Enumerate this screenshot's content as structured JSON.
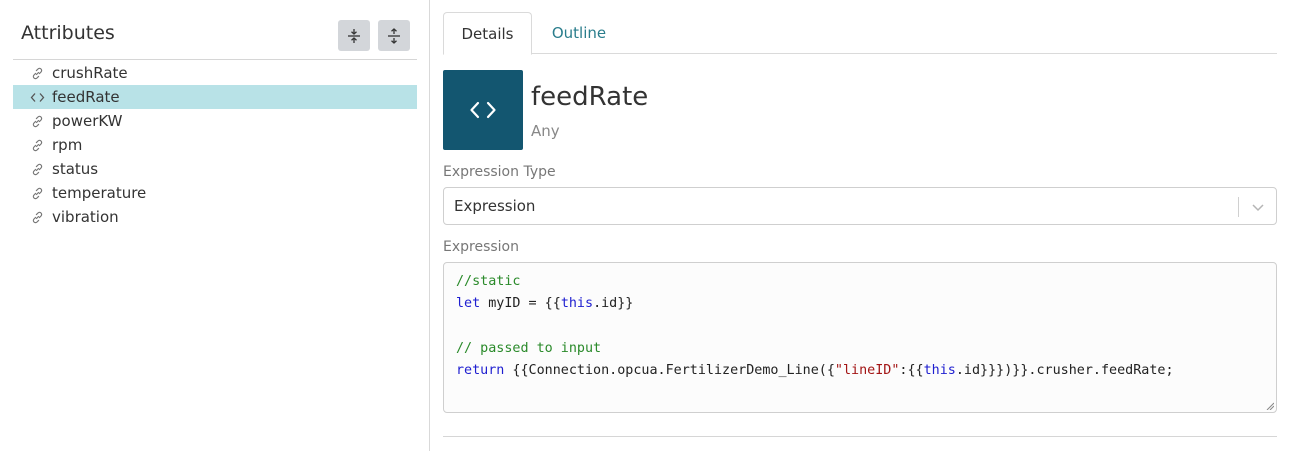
{
  "attributes_panel": {
    "title": "Attributes",
    "collapse_all_icon": "collapse-vertical-icon",
    "expand_all_icon": "expand-vertical-icon",
    "items": [
      {
        "label": "crushRate",
        "icon": "link-icon",
        "selected": false
      },
      {
        "label": "feedRate",
        "icon": "code-icon",
        "selected": true
      },
      {
        "label": "powerKW",
        "icon": "link-icon",
        "selected": false
      },
      {
        "label": "rpm",
        "icon": "link-icon",
        "selected": false
      },
      {
        "label": "status",
        "icon": "link-icon",
        "selected": false
      },
      {
        "label": "temperature",
        "icon": "link-icon",
        "selected": false
      },
      {
        "label": "vibration",
        "icon": "link-icon",
        "selected": false
      }
    ]
  },
  "tabs": [
    {
      "label": "Details",
      "active": true
    },
    {
      "label": "Outline",
      "active": false
    }
  ],
  "details": {
    "icon": "code-icon",
    "name": "feedRate",
    "type": "Any",
    "expression_type_label": "Expression Type",
    "expression_type_value": "Expression",
    "expression_label": "Expression",
    "expression_lines": [
      "//static",
      "let myID = {{this.id}}",
      "",
      "// passed to input",
      "return {{Connection.opcua.FertilizerDemo_Line({\"lineID\":{{this.id}}})}}.crusher.feedRate;"
    ]
  },
  "colors": {
    "accent_teal": "#2a7d8c",
    "selected_row": "#b8e2e7",
    "hero_tile": "#135670"
  }
}
